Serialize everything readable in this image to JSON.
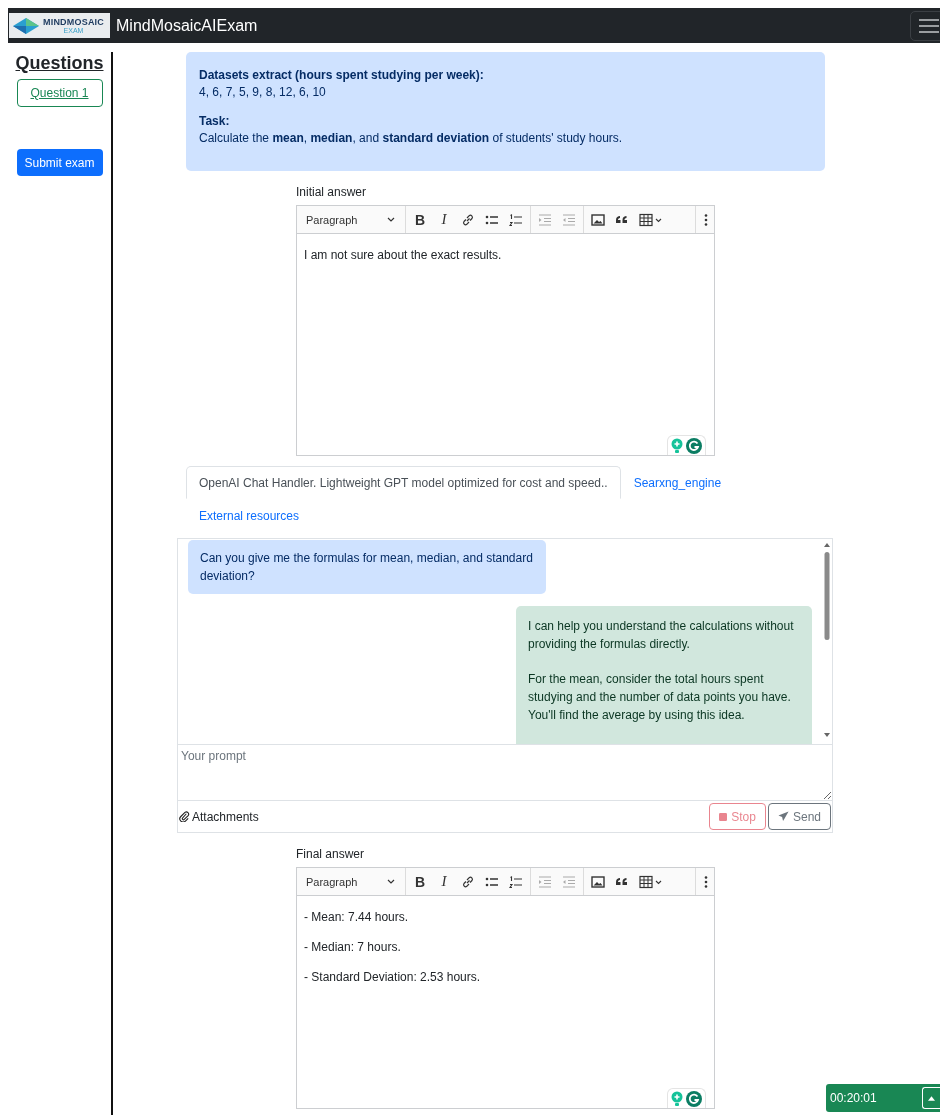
{
  "navbar": {
    "logo_text": "MINDMOSAIC",
    "logo_subtext": "EXAM",
    "brand": "MindMosaicAIExam"
  },
  "sidebar": {
    "title": "Questions",
    "questions": [
      {
        "label": "Question 1",
        "selected": true
      }
    ],
    "submit": "Submit exam"
  },
  "task": {
    "dataset_label": "Datasets extract (hours spent studying per week):",
    "dataset": "4, 6, 7, 5, 9, 8, 12, 6, 10",
    "task_label": "Task:",
    "task_text": "Calculate the **mean**, **median**, and **standard deviation** of students' study hours."
  },
  "initial_answer": {
    "label": "Initial answer",
    "format": "Paragraph",
    "bold_glyph": "B",
    "italic_glyph": "I",
    "paragraphs": [
      "I am not sure about the exact results."
    ]
  },
  "chat": {
    "tabs": [
      {
        "label": "OpenAI Chat Handler. Lightweight GPT model optimized for cost and speed..",
        "selected": true
      },
      {
        "label": "Searxng_engine",
        "selected": false
      },
      {
        "label": "External resources",
        "selected": false
      }
    ],
    "messages": [
      {
        "kind": "question",
        "paragraphs": [
          "Can you give me the formulas for mean, median, and standard deviation?"
        ]
      },
      {
        "kind": "reply",
        "paragraphs": [
          "I can help you understand the calculations without providing the formulas directly.",
          "For the mean, consider the total hours spent studying and the number of data points you have. You'll find the average by using this idea."
        ]
      }
    ],
    "prompt_placeholder": "Your prompt",
    "attachments": "Attachments",
    "stop": {
      "label": "Stop",
      "disabled": true
    },
    "send": {
      "label": "Send",
      "disabled": false
    }
  },
  "final_answer": {
    "label": "Final answer",
    "format": "Paragraph",
    "bold_glyph": "B",
    "italic_glyph": "I",
    "paragraphs": [
      "- Mean: 7.44 hours.",
      "- Median: 7 hours.",
      "- Standard Deviation: 2.53 hours."
    ]
  },
  "timer": {
    "time": "00:20:01"
  }
}
